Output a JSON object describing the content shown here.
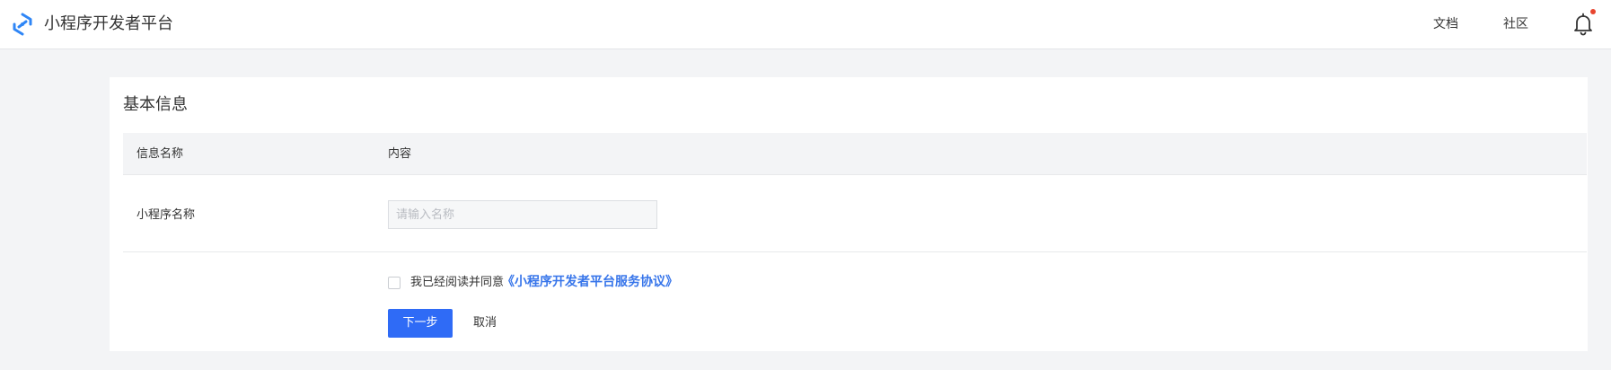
{
  "header": {
    "logo_icon": "mini-program-logo-icon",
    "brand": "小程序开发者平台",
    "nav": {
      "docs": "文档",
      "community": "社区"
    },
    "bell_icon": "bell-icon",
    "notification_dot_color": "#e8452f"
  },
  "card": {
    "title": "基本信息",
    "table": {
      "headers": [
        "信息名称",
        "内容"
      ],
      "rows": [
        {
          "label": "小程序名称",
          "input_value": "",
          "input_placeholder": "请输入名称"
        }
      ]
    },
    "agreement": {
      "checked": false,
      "text": "我已经阅读并同意",
      "link": "《小程序开发者平台服务协议》"
    },
    "actions": {
      "next": "下一步",
      "cancel": "取消"
    }
  },
  "colors": {
    "primary": "#2f6bf6",
    "link": "#3775ea",
    "page_bg": "#f3f4f6",
    "table_header_bg": "#f3f4f6"
  }
}
